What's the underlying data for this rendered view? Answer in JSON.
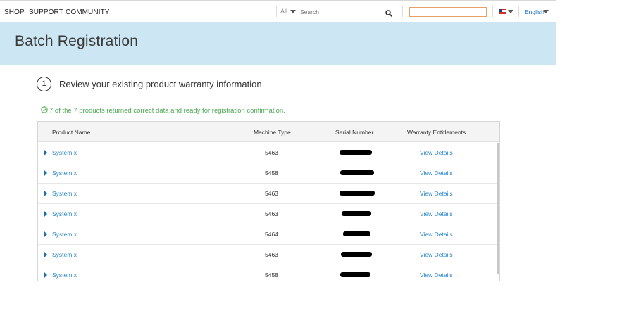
{
  "nav": {
    "links": [
      "SHOP",
      "SUPPORT",
      "COMMUNITY"
    ],
    "search": {
      "scope": "All",
      "placeholder": "Search"
    },
    "language": "English"
  },
  "banner": {
    "title": "Batch Registration"
  },
  "step": {
    "number": "1",
    "title": "Review your existing product warranty information"
  },
  "status": {
    "message": "7 of the 7 products returned correct data and ready for registration confirmation."
  },
  "table": {
    "columns": [
      "Product Name",
      "Machine Type",
      "Serial Number",
      "Warranty Entitlements"
    ],
    "rows": [
      {
        "product": "System x",
        "machine_type": "5463",
        "serial": "",
        "entitlement": "View Details"
      },
      {
        "product": "System x",
        "machine_type": "5458",
        "serial": "",
        "entitlement": "View Details"
      },
      {
        "product": "System x",
        "machine_type": "5463",
        "serial": "",
        "entitlement": "View Details"
      },
      {
        "product": "System x",
        "machine_type": "5463",
        "serial": "",
        "entitlement": "View Details"
      },
      {
        "product": "System x",
        "machine_type": "5464",
        "serial": "",
        "entitlement": "View Details"
      },
      {
        "product": "System x",
        "machine_type": "5463",
        "serial": "",
        "entitlement": "View Details"
      },
      {
        "product": "System x",
        "machine_type": "5458",
        "serial": "",
        "entitlement": "View Details"
      }
    ]
  },
  "icons": {
    "search": "search-icon",
    "status": "check-circle-icon",
    "flag": "us-flag-icon",
    "expander": "caret-right-icon"
  },
  "colors": {
    "banner": "#cde6f4",
    "link": "#2a86c9",
    "success": "#4faa56",
    "search_outline": "#e8a06a"
  }
}
